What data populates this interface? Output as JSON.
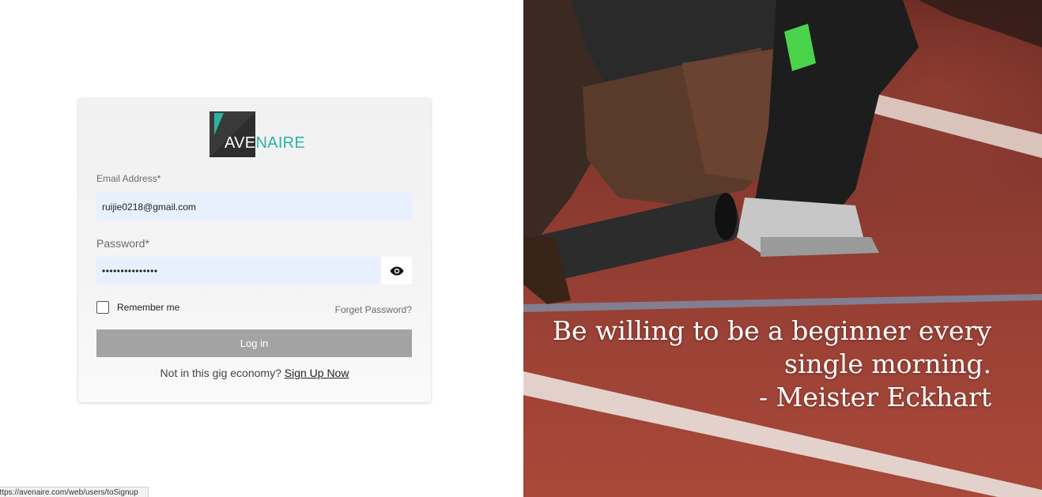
{
  "brand": {
    "logo_part1": "AVE",
    "logo_part2": "NAIRE",
    "accent_color": "#2ab3a3"
  },
  "login_form": {
    "email_label": "Email Address*",
    "email_value": "ruijie0218@gmail.com",
    "password_label": "Password*",
    "password_value": "•••••••••••••••",
    "show_password_icon": "eye-icon",
    "remember_label": "Remember me",
    "remember_checked": false,
    "forget_password_label": "Forget Password?",
    "login_button_label": "Log in",
    "signup_prompt": "Not in this gig economy?",
    "signup_link_label": "Sign Up Now"
  },
  "status_bar": {
    "url": "https://avenaire.com/web/users/toSignup"
  },
  "hero": {
    "quote_line1": "Be willing to be a beginner every",
    "quote_line2": "single morning.",
    "quote_line3": "- Meister Eckhart"
  }
}
